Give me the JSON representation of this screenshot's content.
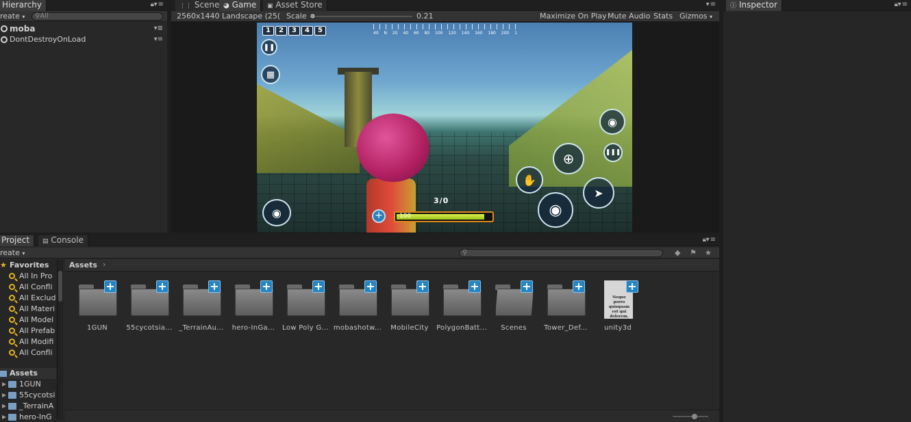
{
  "hierarchy": {
    "tab": "Hierarchy",
    "create": "reate",
    "search_placeholder": "All",
    "rows": [
      {
        "label": "moba"
      },
      {
        "label": "DontDestroyOnLoad"
      }
    ]
  },
  "game": {
    "tabs": [
      "Scene",
      "Game",
      "Asset Store"
    ],
    "resolution": "2560x1440 Landscape (25(",
    "scale_label": "Scale",
    "scale_value": "0.21",
    "buttons": [
      "Maximize On Play",
      "Mute Audio",
      "Stats",
      "Gizmos"
    ],
    "weapon_slots": [
      "1",
      "2",
      "3",
      "4",
      "5"
    ],
    "compass_labels": [
      "40",
      "N",
      "20",
      "40",
      "60",
      "80",
      "100",
      "120",
      "140",
      "160",
      "180",
      "200",
      "1"
    ],
    "ammo": "3/0",
    "health": "100",
    "health_fraction": 0.93
  },
  "inspector": {
    "tab": "Inspector"
  },
  "project": {
    "tabs": [
      "Project",
      "Console"
    ],
    "create": "reate",
    "breadcrumb": "Assets",
    "favorites_header": "Favorites",
    "favorites": [
      "All In Pro",
      "All Confli",
      "All Exclud",
      "All Materi",
      "All Model",
      "All Prefab",
      "All Modifi",
      "All Confli"
    ],
    "assets_header": "Assets",
    "asset_tree": [
      "1GUN",
      "55cycotsi",
      "_TerrainA",
      "hero-InG"
    ],
    "items": [
      {
        "label": "1GUN",
        "type": "folder"
      },
      {
        "label": "55cycotsia...",
        "type": "folder"
      },
      {
        "label": "_TerrainAu...",
        "type": "folder"
      },
      {
        "label": "hero-InGa...",
        "type": "folder"
      },
      {
        "label": "Low Poly G...",
        "type": "folder"
      },
      {
        "label": "mobashotw...",
        "type": "folder"
      },
      {
        "label": "MobileCity",
        "type": "folder"
      },
      {
        "label": "PolygonBatt...",
        "type": "folder"
      },
      {
        "label": "Scenes",
        "type": "folder-open"
      },
      {
        "label": "Tower_Def...",
        "type": "folder"
      },
      {
        "label": "unity3d",
        "type": "document",
        "preview_text": "Neque porro quisquam est qui dolorem."
      }
    ]
  }
}
